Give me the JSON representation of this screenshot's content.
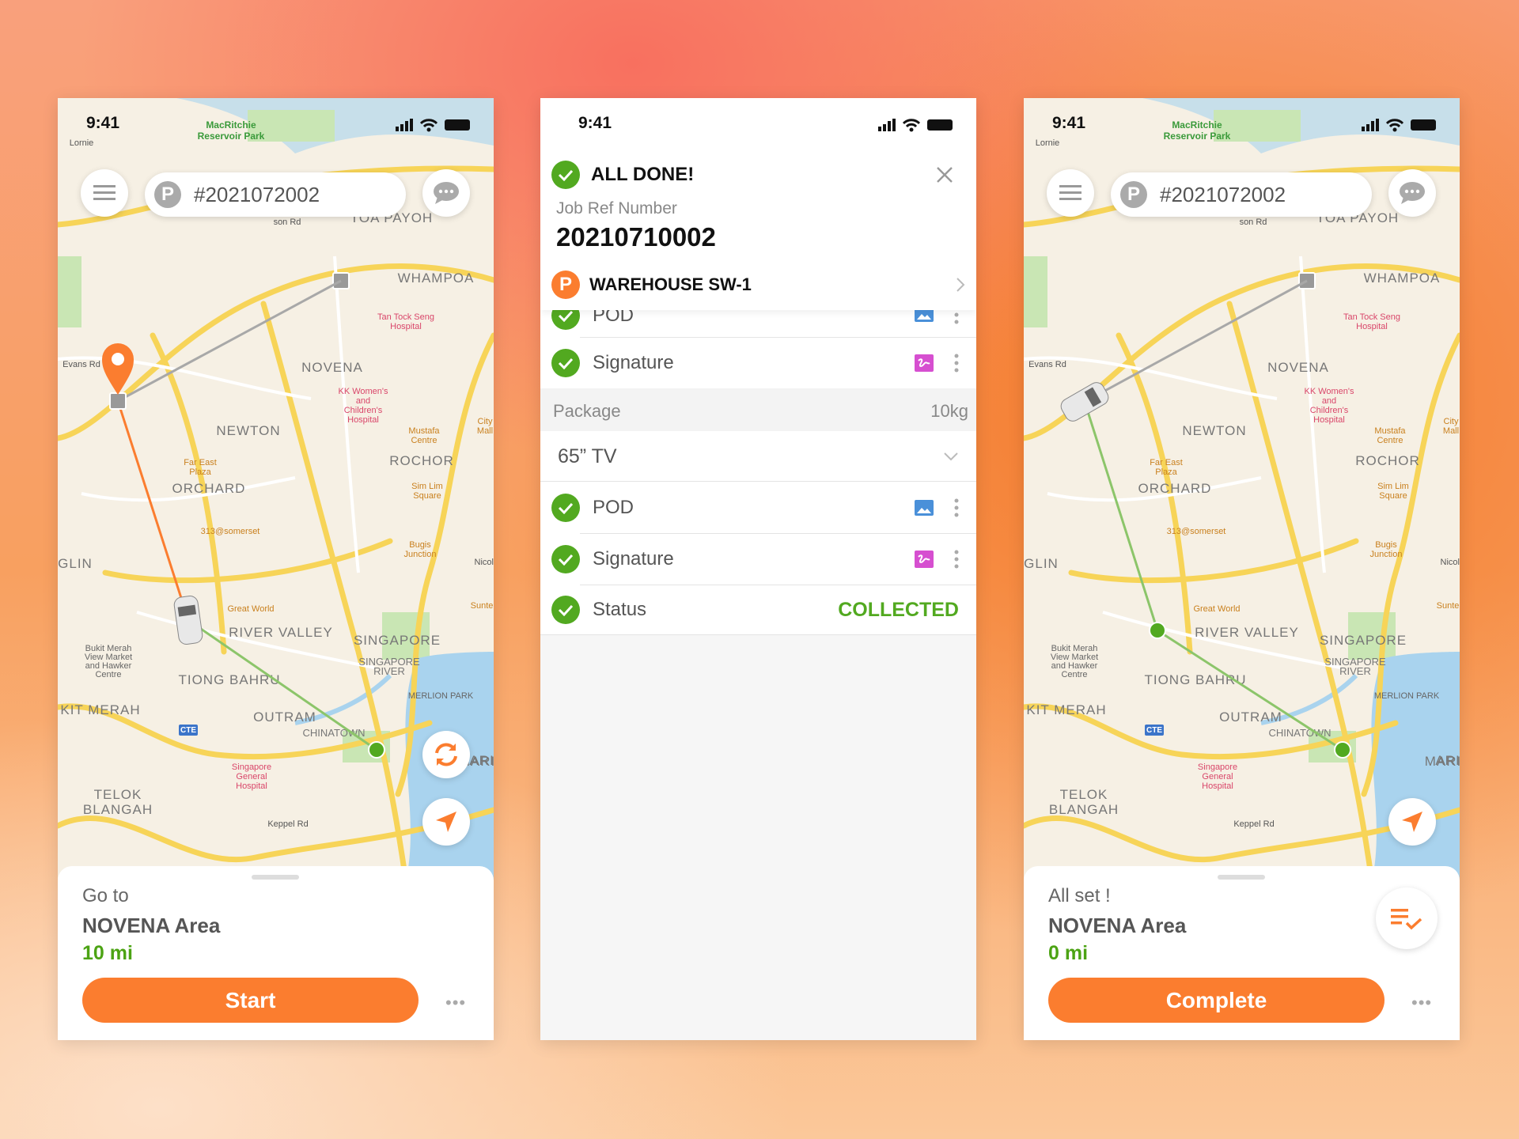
{
  "status": {
    "time": "9:41"
  },
  "colors": {
    "accent": "#fb7d2f",
    "success": "#52a920",
    "route_grey": "#a8a8a8"
  },
  "map": {
    "labels": [
      {
        "t": "MacRitchie",
        "c": "park"
      },
      {
        "t": "Reservoir Park",
        "c": "park"
      },
      {
        "t": "TOA PAYOH",
        "c": "area"
      },
      {
        "t": "WHAMPOA",
        "c": "area"
      },
      {
        "t": "Tan Tock Seng",
        "c": "hosp"
      },
      {
        "t": "Hospital",
        "c": "hosp"
      },
      {
        "t": "NOVENA",
        "c": "area"
      },
      {
        "t": "KK Women's",
        "c": "hosp"
      },
      {
        "t": "and",
        "c": "hosp"
      },
      {
        "t": "Children's",
        "c": "hosp"
      },
      {
        "t": "Hospital",
        "c": "hosp"
      },
      {
        "t": "NEWTON",
        "c": "area"
      },
      {
        "t": "Mustafa",
        "c": "poi"
      },
      {
        "t": "Centre",
        "c": "poi"
      },
      {
        "t": "City",
        "c": "poi"
      },
      {
        "t": "Mall",
        "c": "poi"
      },
      {
        "t": "ROCHOR",
        "c": "area"
      },
      {
        "t": "Far East",
        "c": "poi"
      },
      {
        "t": "Plaza",
        "c": "poi"
      },
      {
        "t": "ORCHARD",
        "c": "area"
      },
      {
        "t": "Sim Lim",
        "c": "poi"
      },
      {
        "t": "Square",
        "c": "poi"
      },
      {
        "t": "313@somerset",
        "c": "poi"
      },
      {
        "t": "Bugis",
        "c": "poi"
      },
      {
        "t": "Junction",
        "c": "poi"
      },
      {
        "t": "GLIN",
        "c": "area"
      },
      {
        "t": "Great World",
        "c": "poi"
      },
      {
        "t": "RIVER VALLEY",
        "c": "area"
      },
      {
        "t": "SINGAPORE",
        "c": "area"
      },
      {
        "t": "SINGAPORE",
        "c": "area2"
      },
      {
        "t": "RIVER",
        "c": "area2"
      },
      {
        "t": "Bukit Merah",
        "c": "grey"
      },
      {
        "t": "View Market",
        "c": "grey"
      },
      {
        "t": "and Hawker",
        "c": "grey"
      },
      {
        "t": "Centre",
        "c": "grey"
      },
      {
        "t": "TIONG BAHRU",
        "c": "area"
      },
      {
        "t": "MERLION PARK",
        "c": "grey"
      },
      {
        "t": "KIT MERAH",
        "c": "area"
      },
      {
        "t": "OUTRAM",
        "c": "area"
      },
      {
        "t": "CHINATOWN",
        "c": "area2"
      },
      {
        "t": "Singapore",
        "c": "hosp"
      },
      {
        "t": "General",
        "c": "hosp"
      },
      {
        "t": "Hospital",
        "c": "hosp"
      },
      {
        "t": "TELOK",
        "c": "area"
      },
      {
        "t": "BLANGAH",
        "c": "area"
      },
      {
        "t": "Keppel Rd",
        "c": "road"
      },
      {
        "t": "Evans Rd",
        "c": "road"
      },
      {
        "t": "Lornie",
        "c": "road"
      },
      {
        "t": "son Rd",
        "c": "road"
      },
      {
        "t": "CTE",
        "c": "badge"
      },
      {
        "t": "Nicoll",
        "c": "road"
      },
      {
        "t": "Sunte",
        "c": "poi"
      },
      {
        "t": "ARI",
        "c": "area"
      },
      {
        "t": "MARI",
        "c": "area"
      }
    ]
  },
  "left": {
    "job_number": "#2021072002",
    "pickup_badge": "P",
    "sheet_title": "Go to",
    "area": "NOVENA Area",
    "distance": "10 mi",
    "button": "Start",
    "more": "•••"
  },
  "middle": {
    "title": "ALL DONE!",
    "job_ref_label": "Job Ref Number",
    "job_ref": "20210710002",
    "pickup_badge": "P",
    "location": "WAREHOUSE SW-1",
    "rows_top": [
      {
        "label": "POD",
        "icon": "image-icon"
      },
      {
        "label": "Signature",
        "icon": "signature-icon"
      }
    ],
    "package_label": "Package",
    "package_weight": "10kg",
    "item": "65” TV",
    "rows": [
      {
        "label": "POD",
        "icon": "image-icon"
      },
      {
        "label": "Signature",
        "icon": "signature-icon"
      }
    ],
    "status_label": "Status",
    "status_value": "COLLECTED"
  },
  "right": {
    "job_number": "#2021072002",
    "pickup_badge": "P",
    "sheet_title": "All set !",
    "area": "NOVENA Area",
    "distance": "0 mi",
    "button": "Complete",
    "more": "•••"
  }
}
